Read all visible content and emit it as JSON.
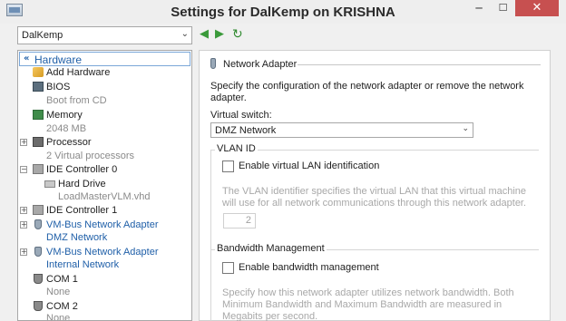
{
  "window": {
    "title": "Settings for DalKemp on KRISHNA",
    "minimize": "─",
    "maximize": "☐",
    "close": "✕"
  },
  "toolbar": {
    "vm_selected": "DalKemp",
    "dropdown_glyph": "⌄",
    "back_glyph": "◀",
    "forward_glyph": "▶",
    "refresh_glyph": "↻"
  },
  "tree": {
    "header": "Hardware",
    "header_collapse_glyph": "«",
    "items": [
      {
        "label": "Add Hardware",
        "sub": "",
        "expander": "",
        "icon": "add-hardware-icon"
      },
      {
        "label": "BIOS",
        "sub": "Boot from CD",
        "expander": "",
        "icon": "bios-icon"
      },
      {
        "label": "Memory",
        "sub": "2048 MB",
        "expander": "",
        "icon": "memory-icon"
      },
      {
        "label": "Processor",
        "sub": "2 Virtual processors",
        "expander": "+",
        "icon": "processor-icon"
      },
      {
        "label": "IDE Controller 0",
        "sub": "",
        "expander": "−",
        "icon": "ide-controller-icon"
      },
      {
        "label": "Hard Drive",
        "sub": "LoadMasterVLM.vhd",
        "expander": "",
        "icon": "hard-drive-icon"
      },
      {
        "label": "IDE Controller 1",
        "sub": "",
        "expander": "+",
        "icon": "ide-controller-icon"
      },
      {
        "label": "VM-Bus Network Adapter",
        "sub": "DMZ Network",
        "expander": "+",
        "icon": "network-adapter-icon"
      },
      {
        "label": "VM-Bus Network Adapter",
        "sub": "Internal Network",
        "expander": "+",
        "icon": "network-adapter-icon"
      },
      {
        "label": "COM 1",
        "sub": "None",
        "expander": "",
        "icon": "com-port-icon"
      },
      {
        "label": "COM 2",
        "sub": "None",
        "expander": "",
        "icon": "com-port-icon"
      }
    ]
  },
  "panel": {
    "title": "Network Adapter",
    "description": "Specify the configuration of the network adapter or remove the network adapter.",
    "virtual_switch_label": "Virtual switch:",
    "virtual_switch_value": "DMZ Network",
    "vlan": {
      "group_title": "VLAN ID",
      "checkbox_label": "Enable virtual LAN identification",
      "checked": false,
      "help_text": "The VLAN identifier specifies the virtual LAN that this virtual machine will use for all network communications through this network adapter.",
      "vlan_id_value": "2"
    },
    "bandwidth": {
      "group_title": "Bandwidth Management",
      "checkbox_label": "Enable bandwidth management",
      "checked": false,
      "help_text": "Specify how this network adapter utilizes network bandwidth. Both Minimum Bandwidth and Maximum Bandwidth are measured in Megabits per second."
    }
  },
  "colors": {
    "link": "#1f5fa8",
    "close_button": "#c75050",
    "disabled_text": "#a8a8a8"
  }
}
